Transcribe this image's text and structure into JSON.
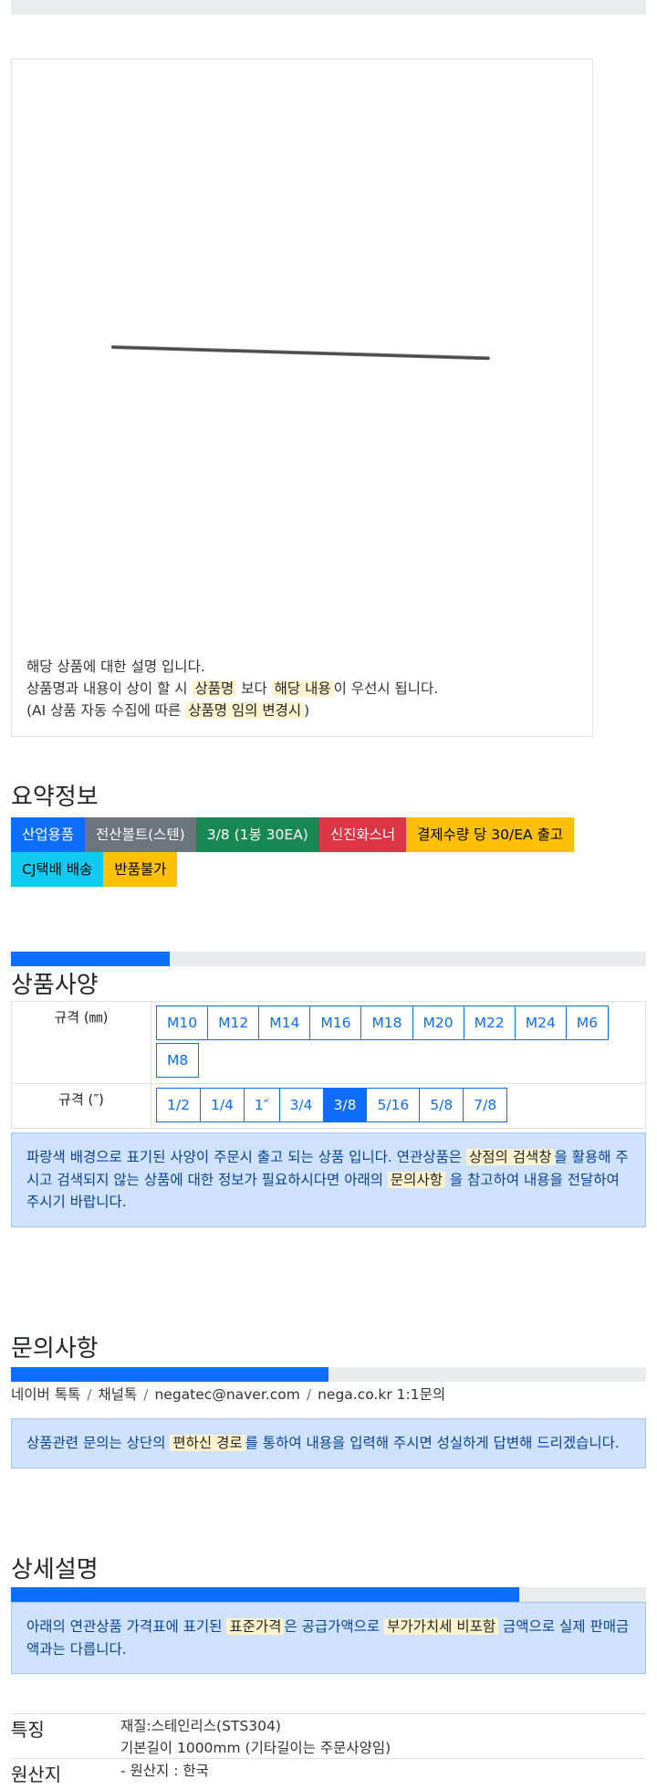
{
  "product": {
    "image_alt": "stainless rod",
    "description_lines": [
      {
        "parts": [
          {
            "text": "해당 상품에 대한 설명 입니다.",
            "mark": false
          }
        ]
      },
      {
        "parts": [
          {
            "text": "상품명과 내용이 상이 할 시 ",
            "mark": false
          },
          {
            "text": "상품명",
            "mark": true
          },
          {
            "text": " 보다 ",
            "mark": false
          },
          {
            "text": "해당 내용",
            "mark": true
          },
          {
            "text": "이 우선시 됩니다.",
            "mark": false
          }
        ]
      },
      {
        "parts": [
          {
            "text": "(AI 상품 자동 수집에 따른 ",
            "mark": false
          },
          {
            "text": "상품명 임의 변경시",
            "mark": true
          },
          {
            "text": ")",
            "mark": false
          }
        ]
      }
    ]
  },
  "summary": {
    "title": "요약정보",
    "badges": [
      {
        "text": "산업용품",
        "color": "blue"
      },
      {
        "text": "전산볼트(스텐)",
        "color": "gray"
      },
      {
        "text": "3/8 (1봉 30EA)",
        "color": "green"
      },
      {
        "text": "신진화스너",
        "color": "red"
      },
      {
        "text": "결제수량 당 30/EA 출고",
        "color": "yellow"
      },
      {
        "text": "CJ택배 배송",
        "color": "cyan"
      },
      {
        "text": "반품불가",
        "color": "yellow"
      }
    ]
  },
  "spec": {
    "progress_fraction": 0.25,
    "title": "상품사양",
    "rows": [
      {
        "label": "규격 (㎜)",
        "options": [
          "M10",
          "M12",
          "M14",
          "M16",
          "M18",
          "M20",
          "M22",
          "M24",
          "M6",
          "M8"
        ],
        "selected": -1
      },
      {
        "label": "규격 (″)",
        "options": [
          "1/2",
          "1/4",
          "1″",
          "3/4",
          "3/8",
          "5/16",
          "5/8",
          "7/8"
        ],
        "selected": 4
      }
    ],
    "notice": [
      {
        "text": "파랑색 배경으로 표기된 사양이 주문시 출고 되는 상품 입니다. 연관상품은 ",
        "mark": false
      },
      {
        "text": "상점의 검색창",
        "mark": true
      },
      {
        "text": "을 활용해 주시고 검색되지 않는 상품에 대한 정보가 필요하시다면 아래의 ",
        "mark": false
      },
      {
        "text": "문의사항",
        "mark": true
      },
      {
        "text": " 을 참고하여 내용을 전달하여 주시기 바랍니다.",
        "mark": false
      }
    ]
  },
  "inquiry": {
    "title": "문의사항",
    "progress_fraction": 0.5,
    "channels": [
      "네이버 톡톡",
      "채널톡",
      "negatec@naver.com",
      "nega.co.kr 1:1문의"
    ],
    "separator": "/",
    "notice": [
      {
        "text": "상품관련 문의는 상단의 ",
        "mark": false
      },
      {
        "text": "편하신 경로",
        "mark": true
      },
      {
        "text": "를 통하여 내용을 입력해 주시면 성실하게 답변해 드리겠습니다.",
        "mark": false
      }
    ]
  },
  "detail": {
    "title": "상세설명",
    "progress_fraction": 0.8,
    "notice": [
      {
        "text": "아래의 연관상품 가격표에 표기된 ",
        "mark": false
      },
      {
        "text": "표준가격",
        "mark": true
      },
      {
        "text": "은 공급가액으로 ",
        "mark": false
      },
      {
        "text": "부가가치세 비포함",
        "mark": true
      },
      {
        "text": " 금액으로 실제 판매금액과는 다릅니다.",
        "mark": false
      }
    ],
    "features_label": "특징",
    "features": [
      "재질:스테인리스(STS304)",
      "기본길이 1000mm (기타길이는 주문사양임)"
    ],
    "origin_label": "원산지",
    "origin": "- 원산지 : 한국"
  }
}
